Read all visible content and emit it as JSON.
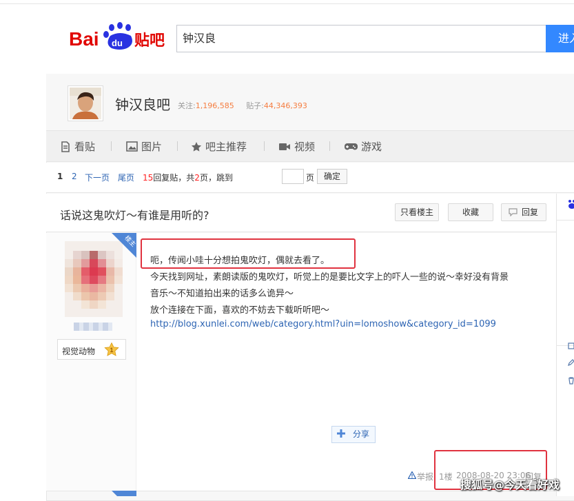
{
  "search": {
    "value": "钟汉良",
    "button_label": "进入"
  },
  "logo": {
    "text": "Bai du 贴吧"
  },
  "forum": {
    "name": "钟汉良吧",
    "follow_label": "关注:",
    "follow_count": "1,196,585",
    "post_label": "贴子:",
    "post_count": "44,346,393"
  },
  "nav": {
    "items": [
      "看贴",
      "图片",
      "吧主推荐",
      "视频",
      "游戏"
    ]
  },
  "pager": {
    "current": "1",
    "page2": "2",
    "next": "下一页",
    "last": "尾页",
    "reply_count": "15",
    "reply_label": "回复贴，共",
    "page_total": "2",
    "page_suffix": "页，跳到",
    "page_unit": "页",
    "confirm": "确定"
  },
  "thread": {
    "title": "话说这鬼吹灯～有谁是用听的?",
    "only_author": "只看楼主",
    "collect": "收藏",
    "reply": "回复"
  },
  "post": {
    "louzhu_tag": "楼主",
    "user_badge": "视觉动物",
    "level": "1",
    "lines": [
      "呃，传闻小哇十分想拍鬼吹灯，偶就去看了。",
      "今天找到网址，素朗读版的鬼吹灯，听觉上的是要比文字上的吓人一些的说～幸好没有背景",
      "音乐～不知道拍出来的话多么诡异～",
      "放个连接在下面，喜欢的不妨去下载听听吧～"
    ],
    "link": "http://blog.xunlei.com/web/category.html?uin=lomoshow&category_id=1099",
    "share": "分享",
    "report": "举报",
    "floor": "1楼",
    "time": "2008-08-20 23:06",
    "reply": "回复"
  },
  "watermark": "搜狐号@今天看好戏",
  "colors": {
    "accent": "#2d64b3",
    "highlight": "#e0323f",
    "count": "#f57d40"
  }
}
